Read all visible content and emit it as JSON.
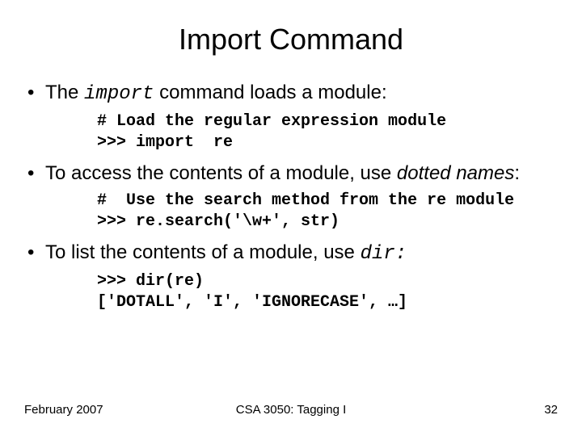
{
  "title": "Import Command",
  "bullet1_pre": "The ",
  "bullet1_code": "import",
  "bullet1_post": " command loads a module:",
  "code1": "# Load the regular expression module\n>>> import  re",
  "bullet2_pre": "To access the contents of a module, use ",
  "bullet2_ital": "dotted names",
  "bullet2_post": ":",
  "code2": "#  Use the search method from the re module\n>>> re.search('\\w+', str)",
  "bullet3_pre": "To list the contents of a module, use ",
  "bullet3_code": "dir:",
  "code3": ">>> dir(re)\n['DOTALL', 'I', 'IGNORECASE', …]",
  "footer_left": "February 2007",
  "footer_center": "CSA 3050: Tagging I",
  "footer_right": "32"
}
